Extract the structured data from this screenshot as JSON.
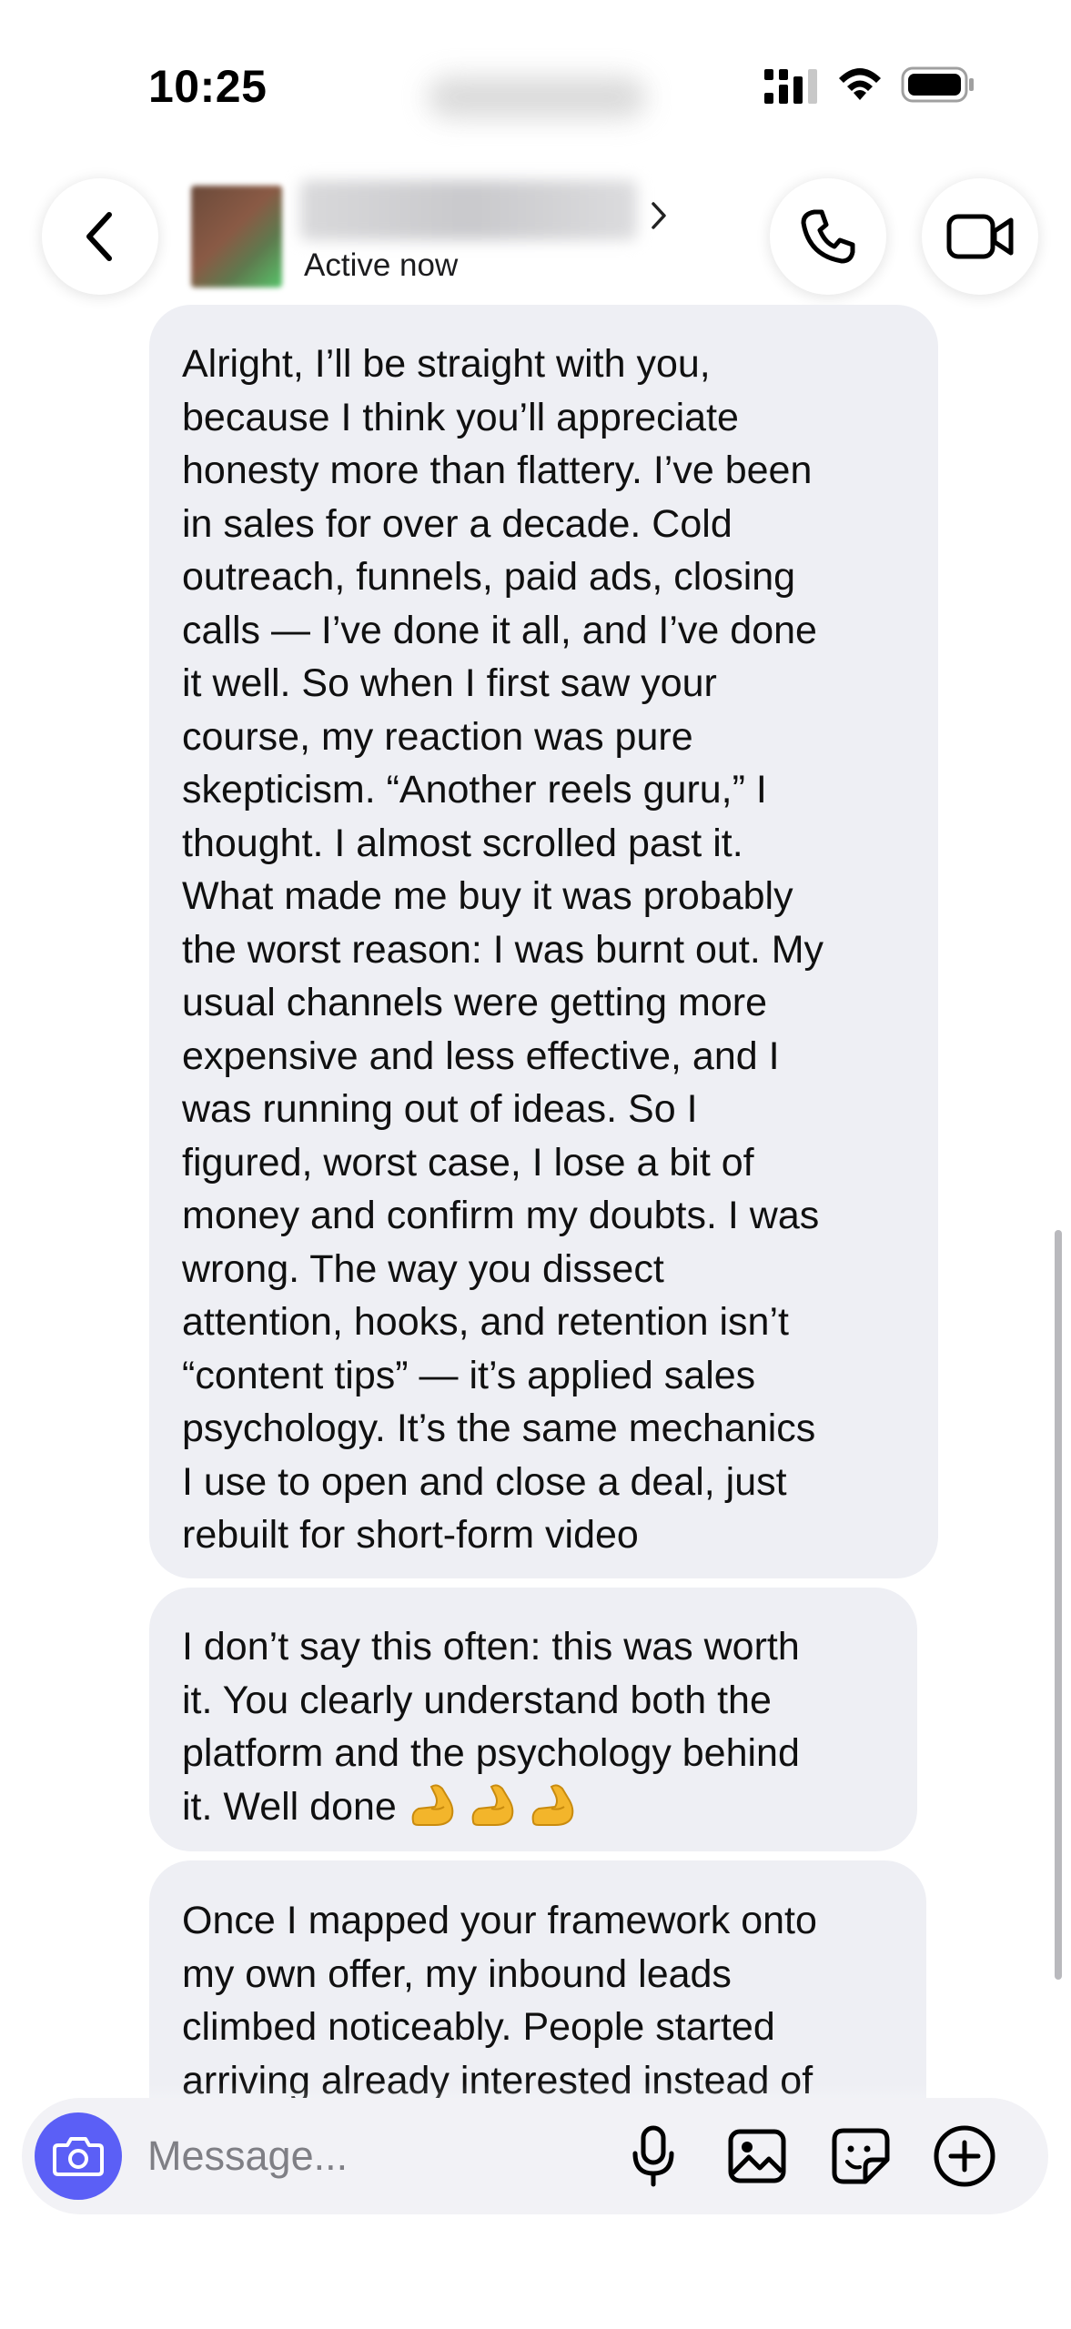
{
  "status_bar": {
    "time": "10:25"
  },
  "header": {
    "presence": "Active now"
  },
  "messages": [
    {
      "text": "Alright, I’ll be straight with you,\nbecause I think you’ll appreciate\nhonesty more than flattery. I’ve been\nin sales for over a decade. Cold\noutreach, funnels, paid ads, closing\ncalls — I’ve done it all, and I’ve done\nit well. So when I first saw your\ncourse, my reaction was pure\nskepticism. “Another reels guru,” I\nthought. I almost scrolled past it.\nWhat made me buy it was probably\nthe worst reason: I was burnt out. My\nusual channels were getting more\nexpensive and less effective, and I\nwas running out of ideas. So I\nfigured, worst case, I lose a bit of\nmoney and confirm my doubts. I was\nwrong. The way you dissect\nattention, hooks, and retention isn’t\n“content tips” — it’s applied sales\npsychology. It’s the same mechanics\nI use to open and close a deal, just\nrebuilt for short-form video"
    },
    {
      "text": "I don’t say this often: this was worth\nit. You clearly understand both the\nplatform and the psychology behind\nit. Well done ",
      "emoji": [
        "flexed-biceps",
        "flexed-biceps",
        "flexed-biceps"
      ]
    },
    {
      "text": "Once I mapped your framework onto\nmy own offer, my inbound leads\nclimbed noticeably. People started\narriving already interested instead of"
    }
  ],
  "composer": {
    "placeholder": "Message...",
    "accent_color": "#5b5ff6"
  },
  "icons": {
    "header": [
      "chevron-left-icon",
      "chevron-right-icon",
      "phone-icon",
      "video-camera-icon"
    ],
    "composer": [
      "camera-icon",
      "microphone-icon",
      "gallery-icon",
      "sticker-icon",
      "plus-icon"
    ]
  }
}
